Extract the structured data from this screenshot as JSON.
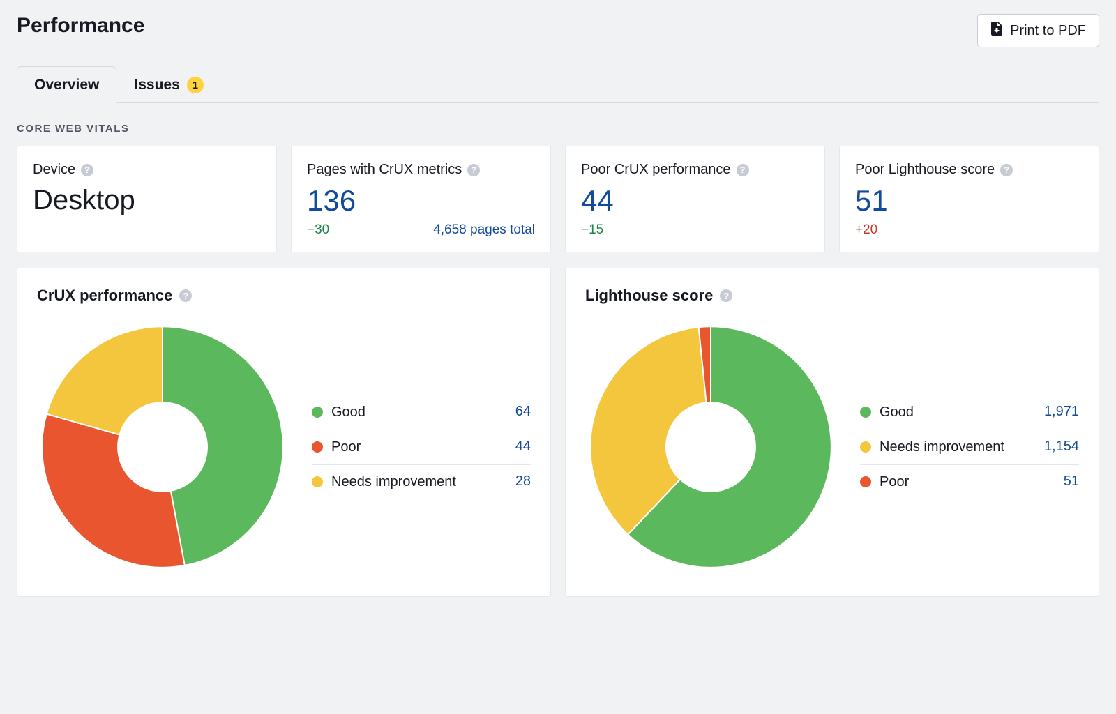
{
  "header": {
    "title": "Performance",
    "print_label": "Print to PDF"
  },
  "tabs": {
    "overview": "Overview",
    "issues": "Issues",
    "issues_count": "1"
  },
  "section_label": "CORE WEB VITALS",
  "cards": {
    "device": {
      "label": "Device",
      "value": "Desktop"
    },
    "crux_pages": {
      "label": "Pages with CrUX metrics",
      "value": "136",
      "delta": "−30",
      "delta_dir": "down",
      "note": "4,658 pages total"
    },
    "crux_poor": {
      "label": "Poor CrUX performance",
      "value": "44",
      "delta": "−15",
      "delta_dir": "down"
    },
    "lh_poor": {
      "label": "Poor Lighthouse score",
      "value": "51",
      "delta": "+20",
      "delta_dir": "up"
    }
  },
  "charts": {
    "crux": {
      "title": "CrUX performance",
      "legend": [
        {
          "label": "Good",
          "value": "64",
          "color": "good"
        },
        {
          "label": "Poor",
          "value": "44",
          "color": "poor"
        },
        {
          "label": "Needs improvement",
          "value": "28",
          "color": "needs"
        }
      ]
    },
    "lighthouse": {
      "title": "Lighthouse score",
      "legend": [
        {
          "label": "Good",
          "value": "1,971",
          "color": "good"
        },
        {
          "label": "Needs improvement",
          "value": "1,154",
          "color": "needs"
        },
        {
          "label": "Poor",
          "value": "51",
          "color": "poor"
        }
      ]
    }
  },
  "colors": {
    "good": "#5cb85c",
    "poor": "#e8552f",
    "needs": "#f4c63d"
  },
  "chart_data": [
    {
      "type": "pie",
      "title": "CrUX performance",
      "series": [
        {
          "name": "Good",
          "value": 64
        },
        {
          "name": "Poor",
          "value": 44
        },
        {
          "name": "Needs improvement",
          "value": 28
        }
      ],
      "inner_radius_ratio": 0.37,
      "start_angle_deg": 0
    },
    {
      "type": "pie",
      "title": "Lighthouse score",
      "series": [
        {
          "name": "Good",
          "value": 1971
        },
        {
          "name": "Needs improvement",
          "value": 1154
        },
        {
          "name": "Poor",
          "value": 51
        }
      ],
      "inner_radius_ratio": 0.37,
      "start_angle_deg": 0
    }
  ]
}
